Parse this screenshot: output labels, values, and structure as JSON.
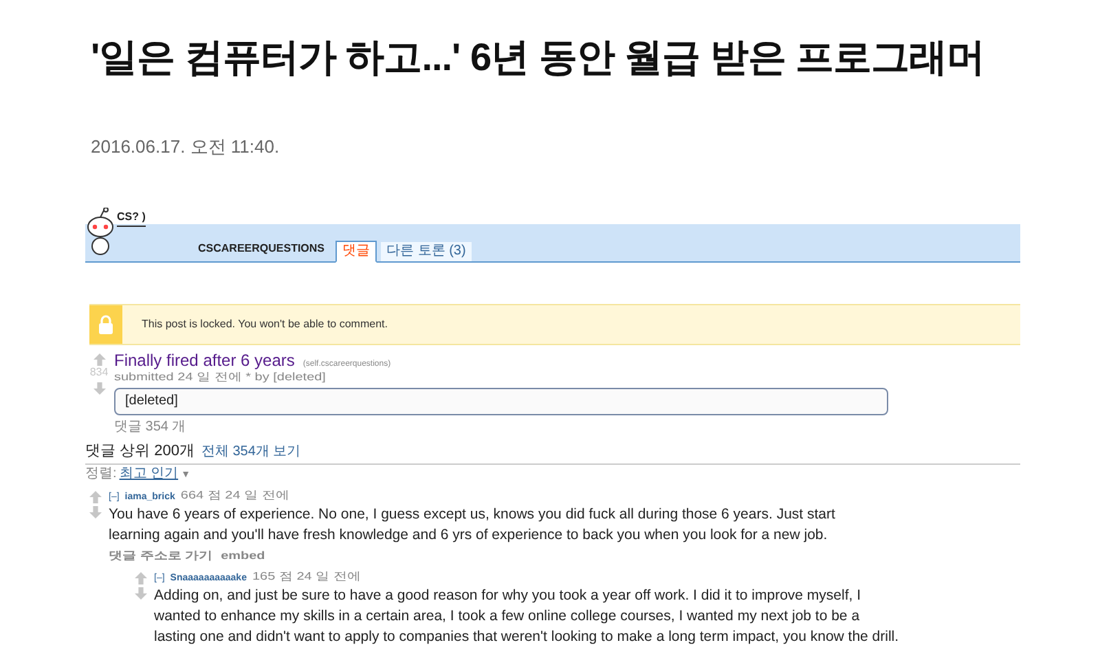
{
  "article": {
    "headline": "'일은 컴퓨터가 하고...' 6년 동안 월급 받은 프로그래머",
    "date": "2016.06.17. 오전 11:40."
  },
  "screenshot": {
    "logo_bubble": "CS? )",
    "subreddit": "CSCAREERQUESTIONS",
    "tabs": [
      {
        "label": "댓글",
        "selected": true
      },
      {
        "label": "다른 토론 (3)",
        "selected": false
      }
    ],
    "locked_notice": "This post is locked. You won't be able to comment.",
    "post": {
      "score": "834",
      "title": "Finally fired after 6 years",
      "domain": "(self.cscareerquestions)",
      "tagline": "submitted 24 일 전에 * by [deleted]",
      "body": "[deleted]",
      "comments_link": "댓글 354 개"
    },
    "comments_header": {
      "title": "댓글 상위 200개",
      "view_all": "전체 354개 보기",
      "sort_label": "정렬:",
      "sort_value": "최고 인기",
      "sort_caret": "▼"
    },
    "comments": [
      {
        "toggle": "[–]",
        "author": "iama_brick",
        "meta": "664 점 24 일 전에",
        "text": "You have 6 years of experience. No one, I guess except us, knows you did fuck all during those 6 years. Just start learning again and you'll have fresh knowledge and 6 yrs of experience to back you when you look for a new job.",
        "links": [
          "댓글 주소로 가기",
          "embed"
        ],
        "children": [
          {
            "toggle": "[–]",
            "author": "Snaaaaaaaaaake",
            "meta": "165 점 24 일 전에",
            "text": "Adding on, and just be sure to have a good reason for why you took a year off work. I did it to improve myself, I wanted to enhance my skills in a certain area, I took a few online college courses, I wanted my next job to be a lasting one and didn't want to apply to companies that weren't looking to make a long term impact, you know the drill."
          }
        ]
      }
    ]
  }
}
